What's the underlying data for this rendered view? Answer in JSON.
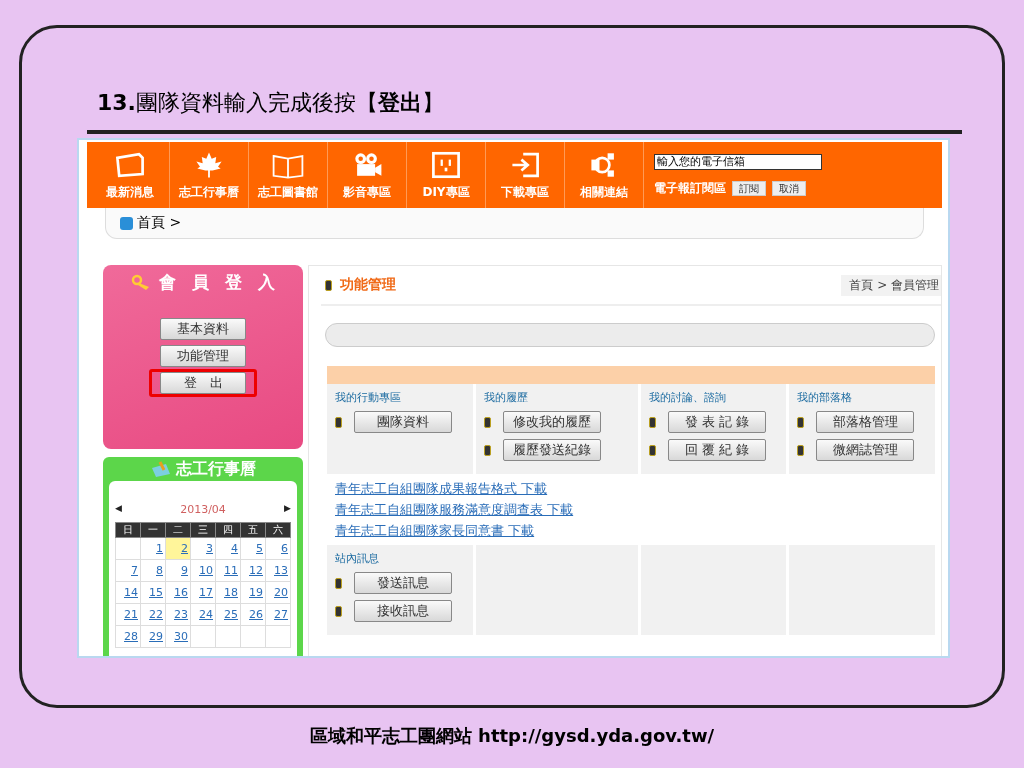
{
  "slide": {
    "title": "**13.**團隊資料輸入完成後按【**登出**】",
    "footer": "區域和平志工團網站 http://gysd.yda.gov.tw/"
  },
  "nav": {
    "items": [
      {
        "label": "最新消息"
      },
      {
        "label": "志工行事曆"
      },
      {
        "label": "志工圖書館"
      },
      {
        "label": "影音專區"
      },
      {
        "label": "DIY專區"
      },
      {
        "label": "下載專區"
      },
      {
        "label": "相關連結"
      }
    ],
    "newsletter": {
      "label": "電子報訂閱區",
      "value": "輸入您的電子信箱",
      "buttons": [
        "訂閱",
        "取消"
      ]
    }
  },
  "breadcrumb": "首頁 >",
  "member_panel": {
    "title": "會 員 登 入",
    "buttons": [
      {
        "label": "基本資料",
        "highlighted": false
      },
      {
        "label": "功能管理",
        "highlighted": false
      },
      {
        "label": "登　出",
        "highlighted": true
      }
    ]
  },
  "calendar": {
    "title": "志工行事曆",
    "month": "2013/04",
    "prev": "◀",
    "next": "▶",
    "weekdays": [
      "日",
      "一",
      "二",
      "三",
      "四",
      "五",
      "六"
    ],
    "weeks": [
      [
        {
          "kind": "blank"
        },
        {
          "kind": "day",
          "day": "1",
          "selected": false
        },
        {
          "kind": "day",
          "day": "2",
          "selected": true
        },
        {
          "kind": "day",
          "day": "3",
          "selected": false
        },
        {
          "kind": "day",
          "day": "4",
          "selected": false
        },
        {
          "kind": "day",
          "day": "5",
          "selected": false
        },
        {
          "kind": "day",
          "day": "6",
          "selected": false
        }
      ],
      [
        {
          "kind": "day",
          "day": "7",
          "selected": false
        },
        {
          "kind": "day",
          "day": "8",
          "selected": false
        },
        {
          "kind": "day",
          "day": "9",
          "selected": false
        },
        {
          "kind": "day",
          "day": "10",
          "selected": false
        },
        {
          "kind": "day",
          "day": "11",
          "selected": false
        },
        {
          "kind": "day",
          "day": "12",
          "selected": false
        },
        {
          "kind": "day",
          "day": "13",
          "selected": false
        }
      ],
      [
        {
          "kind": "day",
          "day": "14",
          "selected": false
        },
        {
          "kind": "day",
          "day": "15",
          "selected": false
        },
        {
          "kind": "day",
          "day": "16",
          "selected": false
        },
        {
          "kind": "day",
          "day": "17",
          "selected": false
        },
        {
          "kind": "day",
          "day": "18",
          "selected": false
        },
        {
          "kind": "day",
          "day": "19",
          "selected": false
        },
        {
          "kind": "day",
          "day": "20",
          "selected": false
        }
      ],
      [
        {
          "kind": "day",
          "day": "21",
          "selected": false
        },
        {
          "kind": "day",
          "day": "22",
          "selected": false
        },
        {
          "kind": "day",
          "day": "23",
          "selected": false
        },
        {
          "kind": "day",
          "day": "24",
          "selected": false
        },
        {
          "kind": "day",
          "day": "25",
          "selected": false
        },
        {
          "kind": "day",
          "day": "26",
          "selected": false
        },
        {
          "kind": "day",
          "day": "27",
          "selected": false
        }
      ],
      [
        {
          "kind": "day",
          "day": "28",
          "selected": false
        },
        {
          "kind": "day",
          "day": "29",
          "selected": false
        },
        {
          "kind": "day",
          "day": "30",
          "selected": false
        },
        {
          "kind": "blank"
        },
        {
          "kind": "blank"
        },
        {
          "kind": "blank"
        },
        {
          "kind": "blank"
        }
      ]
    ]
  },
  "main": {
    "title": "功能管理",
    "breadcrumb": "首頁 > 會員管理",
    "sections": [
      {
        "heading": "我的行動專區",
        "buttons": [
          "團隊資料"
        ]
      },
      {
        "heading": "我的履歷",
        "buttons": [
          "修改我的履歷",
          "履歷發送紀錄"
        ]
      },
      {
        "heading": "我的討論、諮詢",
        "buttons": [
          "發 表 記 錄",
          "回 覆 紀 錄"
        ]
      },
      {
        "heading": "我的部落格",
        "buttons": [
          "部落格管理",
          "微網誌管理"
        ]
      }
    ],
    "links": [
      "青年志工自組團隊成果報告格式 下載",
      "青年志工自組團隊服務滿意度調查表 下載",
      "青年志工自組團隊家長同意書 下載"
    ],
    "messages": {
      "heading": "站內訊息",
      "buttons": [
        "發送訊息",
        "接收訊息"
      ]
    }
  }
}
